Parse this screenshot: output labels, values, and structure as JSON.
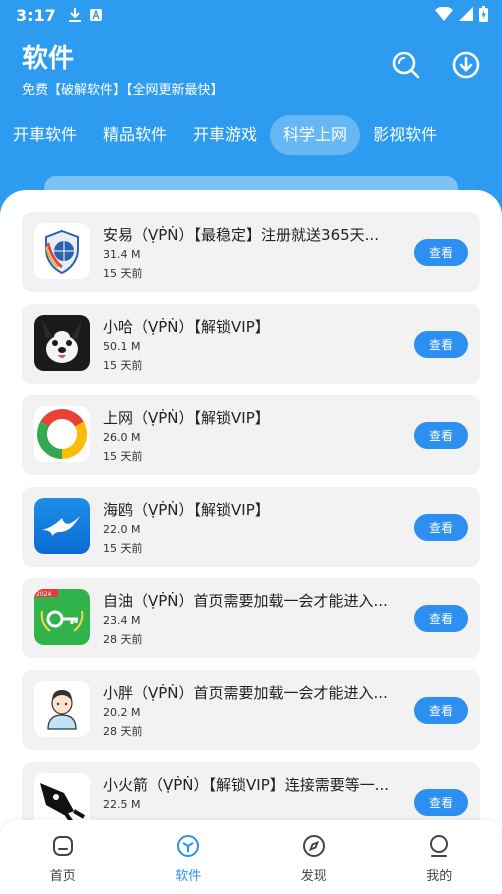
{
  "status": {
    "time": "3:17"
  },
  "header": {
    "title": "软件",
    "subtitle": "免费【破解软件】【全网更新最快】"
  },
  "tabs": [
    {
      "label": "开車软件",
      "active": false
    },
    {
      "label": "精品软件",
      "active": false
    },
    {
      "label": "开車游戏",
      "active": false
    },
    {
      "label": "科学上网",
      "active": true
    },
    {
      "label": "影视软件",
      "active": false
    }
  ],
  "apps": [
    {
      "name": "安易（ṾṖṄ）【最稳定】注册就送365天...",
      "size": "31.4 M",
      "time": "15 天前",
      "button": "查看",
      "icon": "shield-globe-icon"
    },
    {
      "name": "小哈（ṾṖṄ）【解锁VIP】",
      "size": "50.1 M",
      "time": "15 天前",
      "button": "查看",
      "icon": "husky-icon"
    },
    {
      "name": "上网（ṾṖṄ）【解锁VIP】",
      "size": "26.0 M",
      "time": "15 天前",
      "button": "查看",
      "icon": "chrome-ring-icon"
    },
    {
      "name": "海鸥（ṾṖṄ）【解锁VIP】",
      "size": "22.0 M",
      "time": "15 天前",
      "button": "查看",
      "icon": "seagull-icon"
    },
    {
      "name": "自油（ṾṖṄ）首页需要加载一会才能进入...",
      "size": "23.4 M",
      "time": "28 天前",
      "button": "查看",
      "icon": "key-laurel-icon",
      "badge": "2024"
    },
    {
      "name": "小胖（ṾṖṄ）首页需要加载一会才能进入...",
      "size": "20.2 M",
      "time": "28 天前",
      "button": "查看",
      "icon": "boy-avatar-icon"
    },
    {
      "name": "小火箭（ṾṖṄ）【解锁VIP】连接需要等一...",
      "size": "22.5 M",
      "time": "",
      "button": "查看",
      "icon": "rocket-icon"
    }
  ],
  "nav": [
    {
      "label": "首页",
      "icon": "home-icon",
      "active": false
    },
    {
      "label": "软件",
      "icon": "cube-icon",
      "active": true
    },
    {
      "label": "发现",
      "icon": "compass-icon",
      "active": false
    },
    {
      "label": "我的",
      "icon": "user-icon",
      "active": false
    }
  ],
  "colors": {
    "primary": "#2d9bf0",
    "button": "#2d8ff0"
  }
}
